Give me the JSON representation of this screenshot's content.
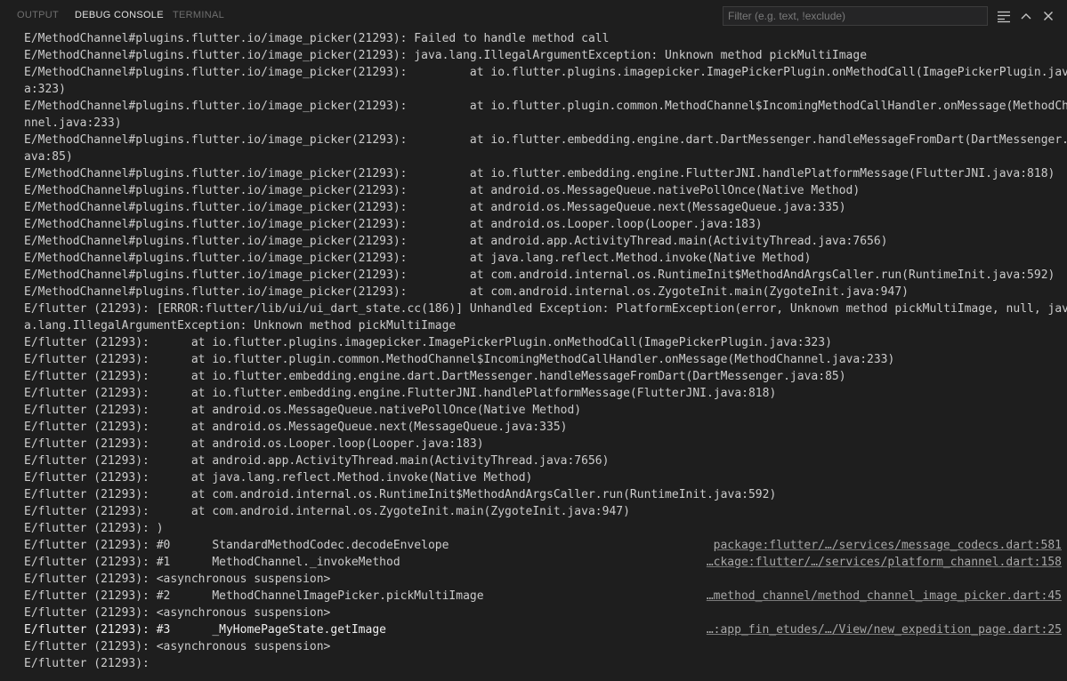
{
  "tabs": [
    {
      "label": "OUTPUT",
      "active": false
    },
    {
      "label": "DEBUG CONSOLE",
      "active": true
    },
    {
      "label": "TERMINAL",
      "active": false
    }
  ],
  "filter": {
    "placeholder": "Filter (e.g. text, !exclude)",
    "value": ""
  },
  "toolbar_icons": [
    "word-wrap-icon",
    "chevron-up-icon",
    "close-icon"
  ],
  "colors": {
    "background": "#1e1e1e",
    "text": "#cccccc",
    "highlight_text": "#f0f0f0",
    "link": "#a8a8a8"
  },
  "console_lines": [
    {
      "text": "E/MethodChannel#plugins.flutter.io/image_picker(21293): Failed to handle method call"
    },
    {
      "text": "E/MethodChannel#plugins.flutter.io/image_picker(21293): java.lang.IllegalArgumentException: Unknown method pickMultiImage"
    },
    {
      "text": "E/MethodChannel#plugins.flutter.io/image_picker(21293):         at io.flutter.plugins.imagepicker.ImagePickerPlugin.onMethodCall(ImagePickerPlugin.jav"
    },
    {
      "text": "a:323)"
    },
    {
      "text": "E/MethodChannel#plugins.flutter.io/image_picker(21293):         at io.flutter.plugin.common.MethodChannel$IncomingMethodCallHandler.onMessage(MethodCha"
    },
    {
      "text": "nnel.java:233)"
    },
    {
      "text": "E/MethodChannel#plugins.flutter.io/image_picker(21293):         at io.flutter.embedding.engine.dart.DartMessenger.handleMessageFromDart(DartMessenger.j"
    },
    {
      "text": "ava:85)"
    },
    {
      "text": "E/MethodChannel#plugins.flutter.io/image_picker(21293):         at io.flutter.embedding.engine.FlutterJNI.handlePlatformMessage(FlutterJNI.java:818)"
    },
    {
      "text": "E/MethodChannel#plugins.flutter.io/image_picker(21293):         at android.os.MessageQueue.nativePollOnce(Native Method)"
    },
    {
      "text": "E/MethodChannel#plugins.flutter.io/image_picker(21293):         at android.os.MessageQueue.next(MessageQueue.java:335)"
    },
    {
      "text": "E/MethodChannel#plugins.flutter.io/image_picker(21293):         at android.os.Looper.loop(Looper.java:183)"
    },
    {
      "text": "E/MethodChannel#plugins.flutter.io/image_picker(21293):         at android.app.ActivityThread.main(ActivityThread.java:7656)"
    },
    {
      "text": "E/MethodChannel#plugins.flutter.io/image_picker(21293):         at java.lang.reflect.Method.invoke(Native Method)"
    },
    {
      "text": "E/MethodChannel#plugins.flutter.io/image_picker(21293):         at com.android.internal.os.RuntimeInit$MethodAndArgsCaller.run(RuntimeInit.java:592)"
    },
    {
      "text": "E/MethodChannel#plugins.flutter.io/image_picker(21293):         at com.android.internal.os.ZygoteInit.main(ZygoteInit.java:947)"
    },
    {
      "text": "E/flutter (21293): [ERROR:flutter/lib/ui/ui_dart_state.cc(186)] Unhandled Exception: PlatformException(error, Unknown method pickMultiImage, null, jav"
    },
    {
      "text": "a.lang.IllegalArgumentException: Unknown method pickMultiImage"
    },
    {
      "text": "E/flutter (21293):      at io.flutter.plugins.imagepicker.ImagePickerPlugin.onMethodCall(ImagePickerPlugin.java:323)"
    },
    {
      "text": "E/flutter (21293):      at io.flutter.plugin.common.MethodChannel$IncomingMethodCallHandler.onMessage(MethodChannel.java:233)"
    },
    {
      "text": "E/flutter (21293):      at io.flutter.embedding.engine.dart.DartMessenger.handleMessageFromDart(DartMessenger.java:85)"
    },
    {
      "text": "E/flutter (21293):      at io.flutter.embedding.engine.FlutterJNI.handlePlatformMessage(FlutterJNI.java:818)"
    },
    {
      "text": "E/flutter (21293):      at android.os.MessageQueue.nativePollOnce(Native Method)"
    },
    {
      "text": "E/flutter (21293):      at android.os.MessageQueue.next(MessageQueue.java:335)"
    },
    {
      "text": "E/flutter (21293):      at android.os.Looper.loop(Looper.java:183)"
    },
    {
      "text": "E/flutter (21293):      at android.app.ActivityThread.main(ActivityThread.java:7656)"
    },
    {
      "text": "E/flutter (21293):      at java.lang.reflect.Method.invoke(Native Method)"
    },
    {
      "text": "E/flutter (21293):      at com.android.internal.os.RuntimeInit$MethodAndArgsCaller.run(RuntimeInit.java:592)"
    },
    {
      "text": "E/flutter (21293):      at com.android.internal.os.ZygoteInit.main(ZygoteInit.java:947)"
    },
    {
      "text": "E/flutter (21293): )"
    },
    {
      "text": "E/flutter (21293): #0      StandardMethodCodec.decodeEnvelope",
      "link": "package:flutter/…/services/message_codecs.dart:581"
    },
    {
      "text": "E/flutter (21293): #1      MethodChannel._invokeMethod",
      "link": "…ckage:flutter/…/services/platform_channel.dart:158"
    },
    {
      "text": "E/flutter (21293): <asynchronous suspension>"
    },
    {
      "text": "E/flutter (21293): #2      MethodChannelImagePicker.pickMultiImage",
      "link": "…method_channel/method_channel_image_picker.dart:45"
    },
    {
      "text": "E/flutter (21293): <asynchronous suspension>"
    },
    {
      "text": "E/flutter (21293): #3      _MyHomePageState.getImage",
      "link": "…:app_fin_etudes/…/View/new_expedition_page.dart:25",
      "bright": true
    },
    {
      "text": "E/flutter (21293): <asynchronous suspension>"
    },
    {
      "text": "E/flutter (21293):"
    }
  ]
}
